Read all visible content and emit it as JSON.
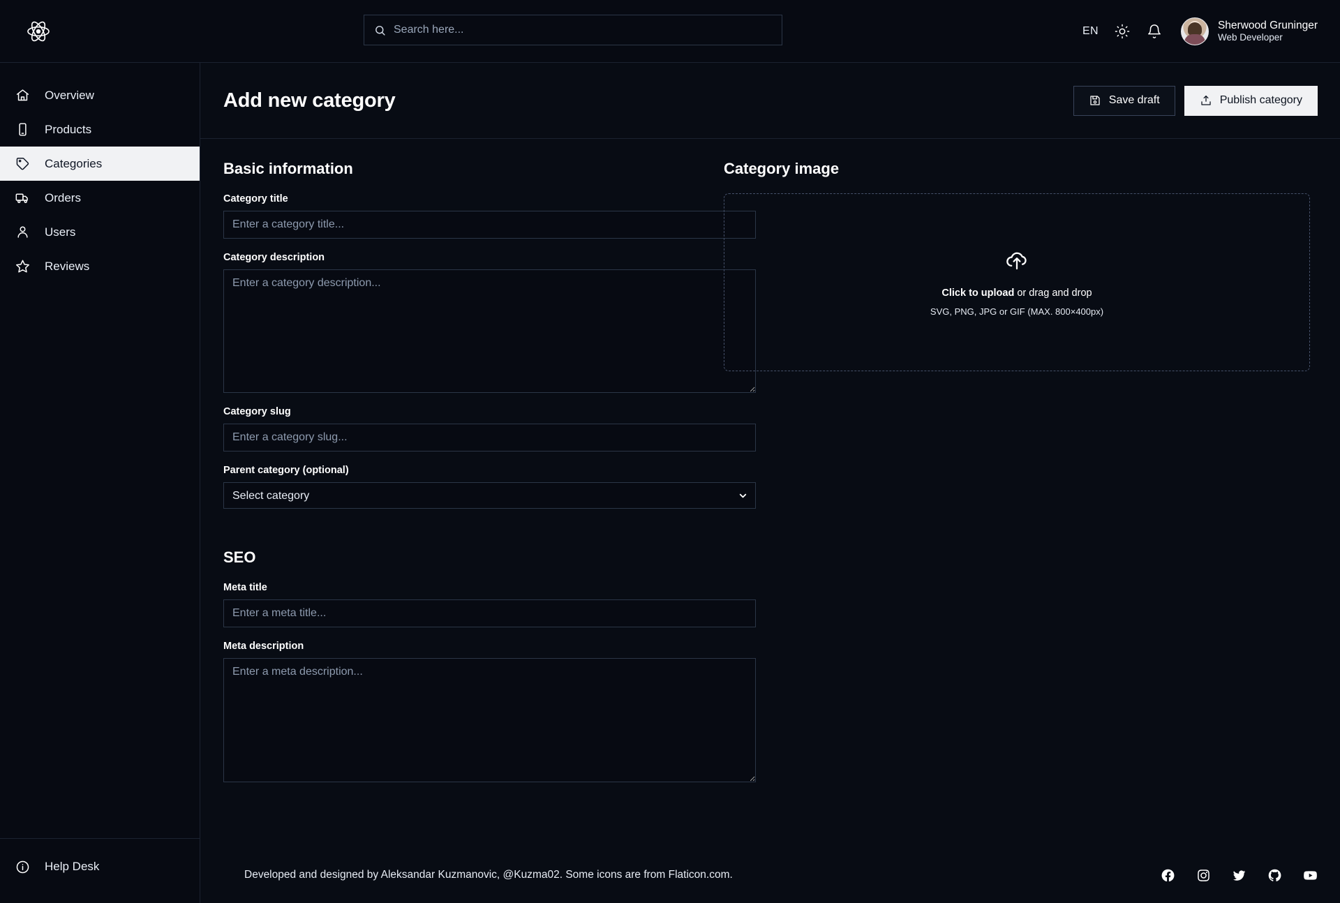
{
  "topbar": {
    "logo_icon": "react-atom-icon",
    "search": {
      "placeholder": "Search here...",
      "value": "",
      "icon": "search-icon"
    },
    "language": "EN",
    "theme_toggle_icon": "sun-icon",
    "notifications_icon": "bell-icon",
    "user": {
      "name": "Sherwood Gruninger",
      "role": "Web Developer",
      "avatar_alt": "user-avatar"
    }
  },
  "sidebar": {
    "items": [
      {
        "label": "Overview",
        "icon": "home-icon",
        "active": false
      },
      {
        "label": "Products",
        "icon": "smartphone-icon",
        "active": false
      },
      {
        "label": "Categories",
        "icon": "tag-icon",
        "active": true
      },
      {
        "label": "Orders",
        "icon": "truck-icon",
        "active": false
      },
      {
        "label": "Users",
        "icon": "user-icon",
        "active": false
      },
      {
        "label": "Reviews",
        "icon": "star-icon",
        "active": false
      }
    ],
    "help": {
      "label": "Help Desk",
      "icon": "info-circle-icon"
    }
  },
  "page": {
    "title": "Add new category",
    "save_draft_label": "Save draft",
    "save_draft_icon": "save-icon",
    "publish_label": "Publish category",
    "publish_icon": "upload-icon"
  },
  "basic_information": {
    "heading": "Basic information",
    "title_label": "Category title",
    "title_placeholder": "Enter a category title...",
    "title_value": "",
    "description_label": "Category description",
    "description_placeholder": "Enter a category description...",
    "description_value": "",
    "slug_label": "Category slug",
    "slug_placeholder": "Enter a category slug...",
    "slug_value": "",
    "parent_label": "Parent category (optional)",
    "parent_selected": "Select category",
    "parent_options": [
      "Select category"
    ]
  },
  "seo": {
    "heading": "SEO",
    "meta_title_label": "Meta title",
    "meta_title_placeholder": "Enter a meta title...",
    "meta_title_value": "",
    "meta_description_label": "Meta description",
    "meta_description_placeholder": "Enter a meta description...",
    "meta_description_value": ""
  },
  "category_image": {
    "heading": "Category image",
    "upload_icon": "cloud-upload-icon",
    "cta_bold": "Click to upload",
    "cta_rest": " or drag and drop",
    "formats": "SVG, PNG, JPG or GIF (MAX. 800×400px)"
  },
  "footer": {
    "credit": "Developed and designed by Aleksandar Kuzmanovic, @Kuzma02. Some icons are from Flaticon.com.",
    "socials": [
      "facebook-icon",
      "instagram-icon",
      "twitter-icon",
      "github-icon",
      "youtube-icon"
    ]
  },
  "colors": {
    "page_bg": "#080c14",
    "panel_bg": "#070a12",
    "border": "#2b3647",
    "active_nav_bg": "#f1f2f4",
    "text": "#ffffff",
    "muted_text": "#8d9aae"
  }
}
